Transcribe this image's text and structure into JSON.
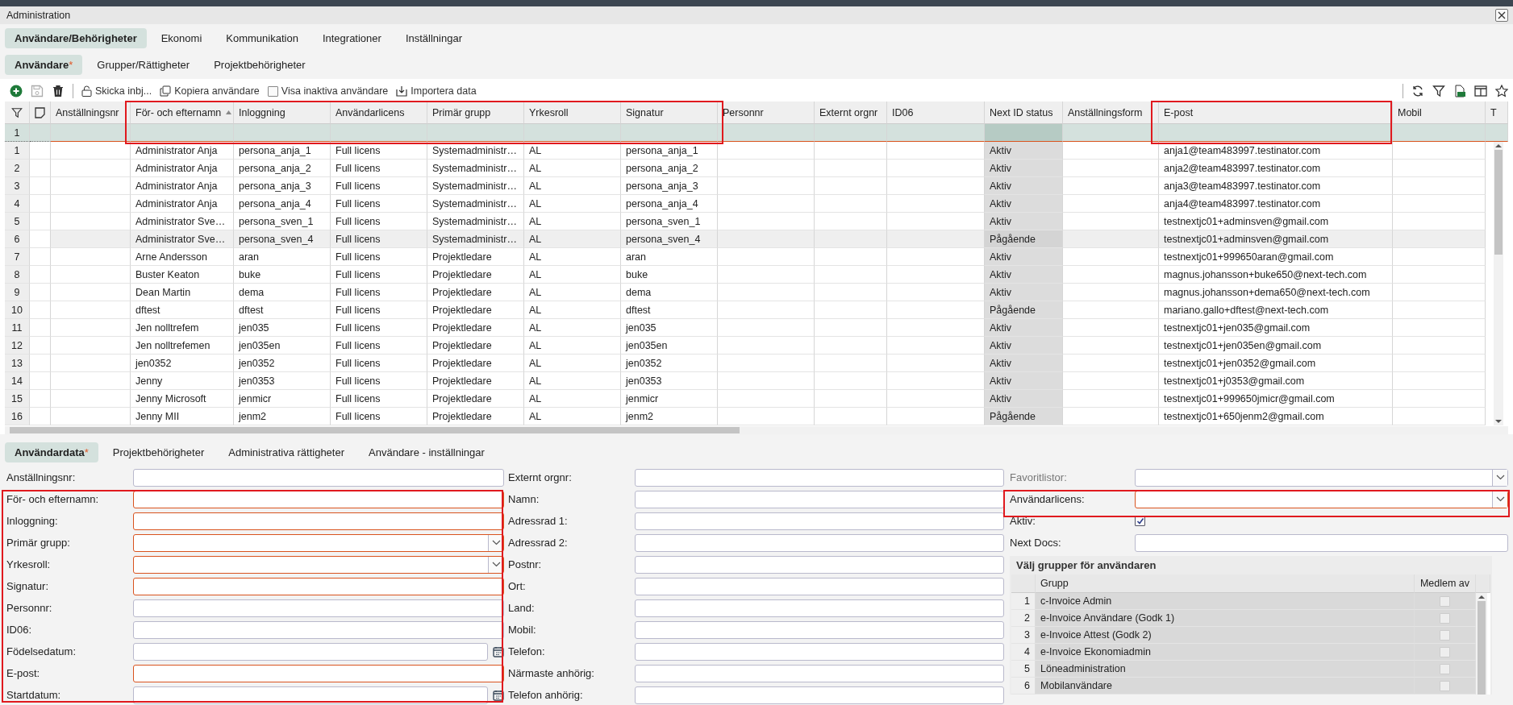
{
  "window": {
    "title": "Administration"
  },
  "main_tabs": [
    {
      "label": "Användare/Behörigheter",
      "selected": true
    },
    {
      "label": "Ekonomi",
      "selected": false
    },
    {
      "label": "Kommunikation",
      "selected": false
    },
    {
      "label": "Integrationer",
      "selected": false
    },
    {
      "label": "Inställningar",
      "selected": false
    }
  ],
  "sub_tabs": [
    {
      "label": "Användare",
      "badge": "*",
      "selected": true
    },
    {
      "label": "Grupper/Rättigheter",
      "selected": false
    },
    {
      "label": "Projektbehörigheter",
      "selected": false
    }
  ],
  "toolbar": {
    "buttons": [
      {
        "kind": "add",
        "disabled": false
      },
      {
        "kind": "save",
        "disabled": true
      },
      {
        "kind": "delete",
        "disabled": false
      }
    ],
    "actions": [
      {
        "kind": "invite",
        "label": "Skicka inbj..."
      },
      {
        "kind": "copy",
        "label": "Kopiera användare"
      },
      {
        "kind": "checkbox",
        "label": "Visa inaktiva användare",
        "checked": false
      },
      {
        "kind": "import",
        "label": "Importera data"
      }
    ]
  },
  "table": {
    "filter_row": {
      "number": "1"
    },
    "columns": [
      {
        "label": "Anställningsnr",
        "sorted": false,
        "readonly": false
      },
      {
        "label": "För- och efternamn",
        "sorted": true,
        "readonly": false
      },
      {
        "label": "Inloggning",
        "sorted": false,
        "readonly": false
      },
      {
        "label": "Användarlicens",
        "sorted": false,
        "readonly": false
      },
      {
        "label": "Primär grupp",
        "sorted": false,
        "readonly": false
      },
      {
        "label": "Yrkesroll",
        "sorted": false,
        "readonly": false
      },
      {
        "label": "Signatur",
        "sorted": false,
        "readonly": false
      },
      {
        "label": "Personnr",
        "sorted": false,
        "readonly": false
      },
      {
        "label": "Externt orgnr",
        "sorted": false,
        "readonly": false
      },
      {
        "label": "ID06",
        "sorted": false,
        "readonly": false
      },
      {
        "label": "Next ID status",
        "sorted": false,
        "readonly": true
      },
      {
        "label": "Anställningsform",
        "sorted": false,
        "readonly": false
      },
      {
        "label": "E-post",
        "sorted": false,
        "readonly": false
      },
      {
        "label": "Mobil",
        "sorted": false,
        "readonly": false
      },
      {
        "label": "T",
        "sorted": false,
        "readonly": false
      }
    ],
    "rows": [
      {
        "number": "1",
        "selected": false,
        "name": "Administrator Anja",
        "login": "persona_anja_1",
        "license": "Full licens",
        "primary_group": "Systemadministr…",
        "role": "AL",
        "signature": "persona_anja_1",
        "next_id_status": "Aktiv",
        "email": "anja1@team483997.testinator.com"
      },
      {
        "number": "2",
        "selected": false,
        "name": "Administrator Anja",
        "login": "persona_anja_2",
        "license": "Full licens",
        "primary_group": "Systemadministr…",
        "role": "AL",
        "signature": "persona_anja_2",
        "next_id_status": "Aktiv",
        "email": "anja2@team483997.testinator.com"
      },
      {
        "number": "3",
        "selected": false,
        "name": "Administrator Anja",
        "login": "persona_anja_3",
        "license": "Full licens",
        "primary_group": "Systemadministr…",
        "role": "AL",
        "signature": "persona_anja_3",
        "next_id_status": "Aktiv",
        "email": "anja3@team483997.testinator.com"
      },
      {
        "number": "4",
        "selected": false,
        "name": "Administrator Anja",
        "login": "persona_anja_4",
        "license": "Full licens",
        "primary_group": "Systemadministr…",
        "role": "AL",
        "signature": "persona_anja_4",
        "next_id_status": "Aktiv",
        "email": "anja4@team483997.testinator.com"
      },
      {
        "number": "5",
        "selected": false,
        "name": "Administrator Sve…",
        "login": "persona_sven_1",
        "license": "Full licens",
        "primary_group": "Systemadministr…",
        "role": "AL",
        "signature": "persona_sven_1",
        "next_id_status": "Aktiv",
        "email": "testnextjc01+adminsven@gmail.com"
      },
      {
        "number": "6",
        "selected": true,
        "name": "Administrator Sve…",
        "login": "persona_sven_4",
        "license": "Full licens",
        "primary_group": "Systemadministr…",
        "role": "AL",
        "signature": "persona_sven_4",
        "next_id_status": "Pågående",
        "email": "testnextjc01+adminsven@gmail.com"
      },
      {
        "number": "7",
        "selected": false,
        "name": "Arne Andersson",
        "login": "aran",
        "license": "Full licens",
        "primary_group": "Projektledare",
        "role": "AL",
        "signature": "aran",
        "next_id_status": "Aktiv",
        "email": "testnextjc01+999650aran@gmail.com"
      },
      {
        "number": "8",
        "selected": false,
        "name": "Buster Keaton",
        "login": "buke",
        "license": "Full licens",
        "primary_group": "Projektledare",
        "role": "AL",
        "signature": "buke",
        "next_id_status": "Aktiv",
        "email": "magnus.johansson+buke650@next-tech.com"
      },
      {
        "number": "9",
        "selected": false,
        "name": "Dean Martin",
        "login": "dema",
        "license": "Full licens",
        "primary_group": "Projektledare",
        "role": "AL",
        "signature": "dema",
        "next_id_status": "Aktiv",
        "email": "magnus.johansson+dema650@next-tech.com"
      },
      {
        "number": "10",
        "selected": false,
        "name": "dftest",
        "login": "dftest",
        "license": "Full licens",
        "primary_group": "Projektledare",
        "role": "AL",
        "signature": "dftest",
        "next_id_status": "Pågående",
        "email": "mariano.gallo+dftest@next-tech.com"
      },
      {
        "number": "11",
        "selected": false,
        "name": "Jen nolltrefem",
        "login": "jen035",
        "license": "Full licens",
        "primary_group": "Projektledare",
        "role": "AL",
        "signature": "jen035",
        "next_id_status": "Aktiv",
        "email": "testnextjc01+jen035@gmail.com"
      },
      {
        "number": "12",
        "selected": false,
        "name": "Jen nolltrefemen",
        "login": "jen035en",
        "license": "Full licens",
        "primary_group": "Projektledare",
        "role": "AL",
        "signature": "jen035en",
        "next_id_status": "Aktiv",
        "email": "testnextjc01+jen035en@gmail.com"
      },
      {
        "number": "13",
        "selected": false,
        "name": "jen0352",
        "login": "jen0352",
        "license": "Full licens",
        "primary_group": "Projektledare",
        "role": "AL",
        "signature": "jen0352",
        "next_id_status": "Aktiv",
        "email": "testnextjc01+jen0352@gmail.com"
      },
      {
        "number": "14",
        "selected": false,
        "name": "Jenny",
        "login": "jen0353",
        "license": "Full licens",
        "primary_group": "Projektledare",
        "role": "AL",
        "signature": "jen0353",
        "next_id_status": "Aktiv",
        "email": "testnextjc01+j0353@gmail.com"
      },
      {
        "number": "15",
        "selected": false,
        "name": "Jenny Microsoft",
        "login": "jenmicr",
        "license": "Full licens",
        "primary_group": "Projektledare",
        "role": "AL",
        "signature": "jenmicr",
        "next_id_status": "Aktiv",
        "email": "testnextjc01+999650jmicr@gmail.com"
      },
      {
        "number": "16",
        "selected": false,
        "name": "Jenny MII",
        "login": "jenm2",
        "license": "Full licens",
        "primary_group": "Projektledare",
        "role": "AL",
        "signature": "jenm2",
        "next_id_status": "Pågående",
        "email": "testnextjc01+650jenm2@gmail.com"
      }
    ]
  },
  "detail_tabs": [
    {
      "label": "Användardata",
      "badge": "*",
      "selected": true
    },
    {
      "label": "Projektbehörigheter",
      "selected": false
    },
    {
      "label": "Administrativa rättigheter",
      "selected": false
    },
    {
      "label": "Användare - inställningar",
      "selected": false
    }
  ],
  "form": {
    "left": [
      {
        "label": "Anställningsnr:",
        "kind": "text",
        "required": false
      },
      {
        "label": "För- och efternamn:",
        "kind": "text",
        "required": true
      },
      {
        "label": "Inloggning:",
        "kind": "text",
        "required": true
      },
      {
        "label": "Primär grupp:",
        "kind": "select",
        "required": true
      },
      {
        "label": "Yrkesroll:",
        "kind": "select",
        "required": true
      },
      {
        "label": "Signatur:",
        "kind": "text",
        "required": true
      },
      {
        "label": "Personnr:",
        "kind": "text",
        "required": false
      },
      {
        "label": "ID06:",
        "kind": "text",
        "required": false
      },
      {
        "label": "Födelsedatum:",
        "kind": "date",
        "required": false
      },
      {
        "label": "E-post:",
        "kind": "text",
        "required": true
      },
      {
        "label": "Startdatum:",
        "kind": "date",
        "required": false
      }
    ],
    "middle": [
      {
        "label": "Externt orgnr:",
        "kind": "text",
        "required": false
      },
      {
        "label": "Namn:",
        "kind": "text",
        "required": false
      },
      {
        "label": "Adressrad 1:",
        "kind": "text",
        "required": false
      },
      {
        "label": "Adressrad 2:",
        "kind": "text",
        "required": false
      },
      {
        "label": "Postnr:",
        "kind": "text",
        "required": false
      },
      {
        "label": "Ort:",
        "kind": "text",
        "required": false
      },
      {
        "label": "Land:",
        "kind": "text",
        "required": false
      },
      {
        "label": "Mobil:",
        "kind": "text",
        "required": false
      },
      {
        "label": "Telefon:",
        "kind": "text",
        "required": false
      },
      {
        "label": "Närmaste anhörig:",
        "kind": "text",
        "required": false
      },
      {
        "label": "Telefon anhörig:",
        "kind": "text",
        "required": false
      }
    ],
    "right": [
      {
        "label": "Favoritlistor:",
        "kind": "select",
        "required": false,
        "disabled": true
      },
      {
        "label": "Användarlicens:",
        "kind": "select",
        "required": true,
        "disabled": false
      },
      {
        "label": "Aktiv:",
        "kind": "checkbox",
        "disabled": false,
        "checked": true
      },
      {
        "label": "Next Docs:",
        "kind": "text",
        "required": false,
        "disabled": false
      }
    ]
  },
  "groups": {
    "title": "Välj grupper för användaren",
    "columns": [
      "Grupp",
      "Medlem av"
    ],
    "rows": [
      {
        "number": "1",
        "name": "c-Invoice Admin",
        "member": false
      },
      {
        "number": "2",
        "name": "e-Invoice Användare (Godk 1)",
        "member": false
      },
      {
        "number": "3",
        "name": "e-Invoice Attest (Godk 2)",
        "member": false
      },
      {
        "number": "4",
        "name": "e-Invoice Ekonomiadmin",
        "member": false
      },
      {
        "number": "5",
        "name": "Löneadministration",
        "member": false
      },
      {
        "number": "6",
        "name": "Mobilanvändare",
        "member": false
      }
    ]
  }
}
